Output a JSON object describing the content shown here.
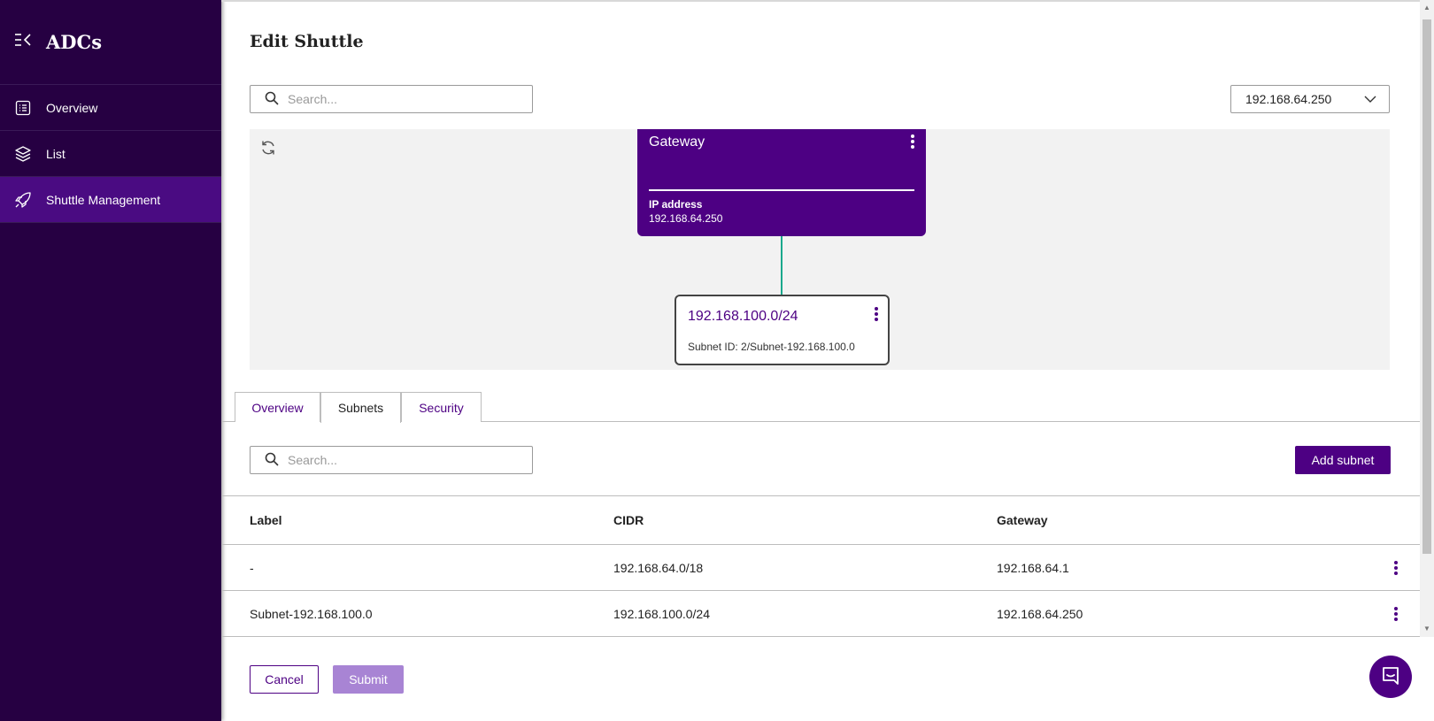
{
  "sidebar": {
    "title": "ADCs",
    "items": [
      {
        "label": "Overview",
        "icon": "list-doc-icon"
      },
      {
        "label": "List",
        "icon": "layers-icon"
      },
      {
        "label": "Shuttle Management",
        "icon": "rocket-icon",
        "active": true
      }
    ]
  },
  "page": {
    "title": "Edit Shuttle",
    "search_placeholder": "Search...",
    "selected_gateway": "192.168.64.250"
  },
  "diagram": {
    "gateway": {
      "title": "Gateway",
      "ip_label": "IP address",
      "ip_value": "192.168.64.250"
    },
    "subnet": {
      "title": "192.168.100.0/24",
      "subtitle": "Subnet ID: 2/Subnet-192.168.100.0"
    }
  },
  "tabs": [
    {
      "label": "Overview"
    },
    {
      "label": "Subnets",
      "active": true
    },
    {
      "label": "Security"
    }
  ],
  "subnets": {
    "search_placeholder": "Search...",
    "add_label": "Add subnet",
    "columns": [
      "Label",
      "CIDR",
      "Gateway"
    ],
    "rows": [
      {
        "label": "-",
        "cidr": "192.168.64.0/18",
        "gateway": "192.168.64.1"
      },
      {
        "label": "Subnet-192.168.100.0",
        "cidr": "192.168.100.0/24",
        "gateway": "192.168.64.250"
      }
    ]
  },
  "footer": {
    "cancel_label": "Cancel",
    "submit_label": "Submit"
  },
  "colors": {
    "sidebar_bg": "#260042",
    "accent": "#4d0083",
    "connector": "#1aa88c",
    "submit_disabled": "#a884d4"
  }
}
